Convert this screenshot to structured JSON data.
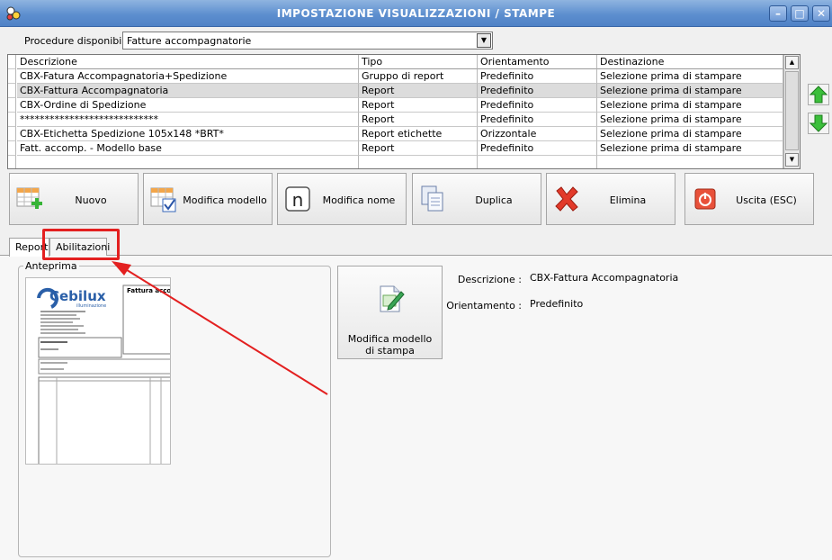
{
  "window": {
    "title": "IMPOSTAZIONE VISUALIZZAZIONI / STAMPE"
  },
  "procedure": {
    "label": "Procedure disponibili :",
    "value": "Fatture accompagnatorie"
  },
  "grid": {
    "columns": [
      "Descrizione",
      "Tipo",
      "Orientamento",
      "Destinazione"
    ],
    "rows": [
      [
        "CBX-Fatura Accompagnatoria+Spedizione",
        "Gruppo di report",
        "Predefinito",
        "Selezione prima di stampare"
      ],
      [
        "CBX-Fattura Accompagnatoria",
        "Report",
        "Predefinito",
        "Selezione prima di stampare"
      ],
      [
        "CBX-Ordine di Spedizione",
        "Report",
        "Predefinito",
        "Selezione prima di stampare"
      ],
      [
        "****************************",
        "Report",
        "Predefinito",
        "Selezione prima di stampare"
      ],
      [
        "CBX-Etichetta Spedizione 105x148 *BRT*",
        "Report etichette",
        "Orizzontale",
        "Selezione prima di stampare"
      ],
      [
        "Fatt. accomp. - Modello base",
        "Report",
        "Predefinito",
        "Selezione prima di stampare"
      ]
    ],
    "selected_row": 1
  },
  "toolbar": {
    "nuovo": "Nuovo",
    "modifica_modello": "Modifica modello",
    "modifica_nome": "Modifica nome",
    "modifica_nome_glyph": "n",
    "duplica": "Duplica",
    "elimina": "Elimina",
    "uscita": "Uscita (ESC)"
  },
  "tabs": {
    "report": "Report",
    "abilitazioni": "Abilitazioni"
  },
  "preview": {
    "group_label": "Anteprima",
    "logo": "Cebilux",
    "logo_sub": "illuminazione",
    "doc_title": "Fattura accomp"
  },
  "edit_template_button": "Modifica modello di stampa",
  "details": {
    "descrizione_label": "Descrizione :",
    "descrizione_value": "CBX-Fattura Accompagnatoria",
    "orientamento_label": "Orientamento :",
    "orientamento_value": "Predefinito"
  },
  "colors": {
    "highlight": "#e6f000",
    "annotation": "#e32020",
    "titlebar": "#5d8fcf"
  }
}
